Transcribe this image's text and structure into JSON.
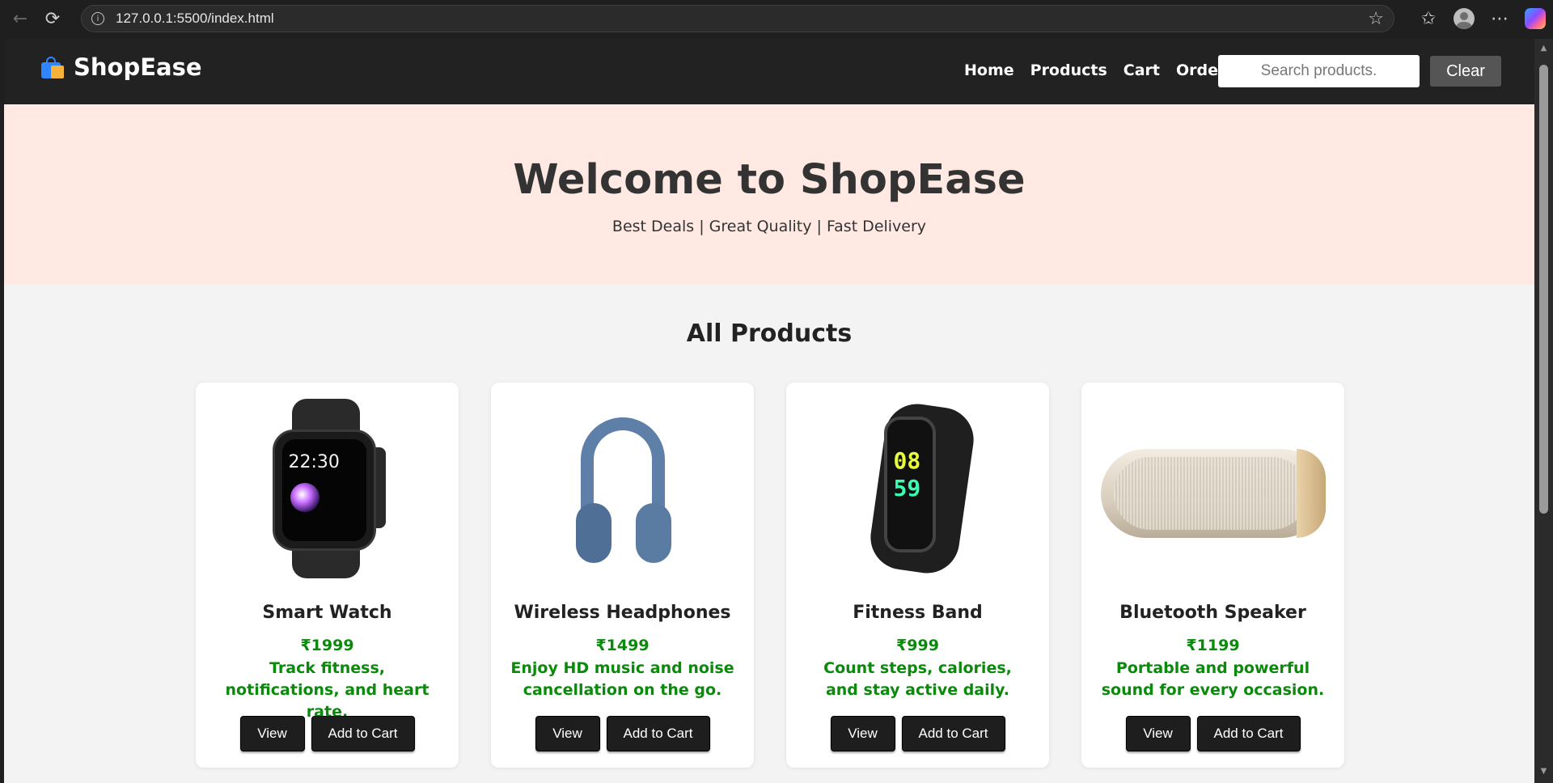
{
  "browser": {
    "url": "127.0.0.1:5500/index.html"
  },
  "site": {
    "brand": "ShopEase",
    "nav": [
      "Home",
      "Products",
      "Cart",
      "Orders"
    ],
    "search_placeholder": "Search products.",
    "clear_label": "Clear"
  },
  "hero": {
    "title": "Welcome to ShopEase",
    "subtitle": "Best Deals | Great Quality | Fast Delivery"
  },
  "products_section": {
    "title": "All Products"
  },
  "products": [
    {
      "name": "Smart Watch",
      "price": "₹1999",
      "description": "Track fitness, notifications, and heart rate.",
      "view_label": "View",
      "cart_label": "Add to Cart"
    },
    {
      "name": "Wireless Headphones",
      "price": "₹1499",
      "description": "Enjoy HD music and noise cancellation on the go.",
      "view_label": "View",
      "cart_label": "Add to Cart"
    },
    {
      "name": "Fitness Band",
      "price": "₹999",
      "description": "Count steps, calories, and stay active daily.",
      "view_label": "View",
      "cart_label": "Add to Cart"
    },
    {
      "name": "Bluetooth Speaker",
      "price": "₹1199",
      "description": "Portable and powerful sound for every occasion.",
      "view_label": "View",
      "cart_label": "Add to Cart"
    }
  ],
  "watch_face": {
    "time": "22:30"
  },
  "band_face": {
    "hours": "08",
    "minutes": "59"
  },
  "colors": {
    "header_bg": "#222222",
    "hero_bg": "#ffe9e2",
    "price_green": "#0a8a0a",
    "button_bg": "#1e1e1e"
  }
}
